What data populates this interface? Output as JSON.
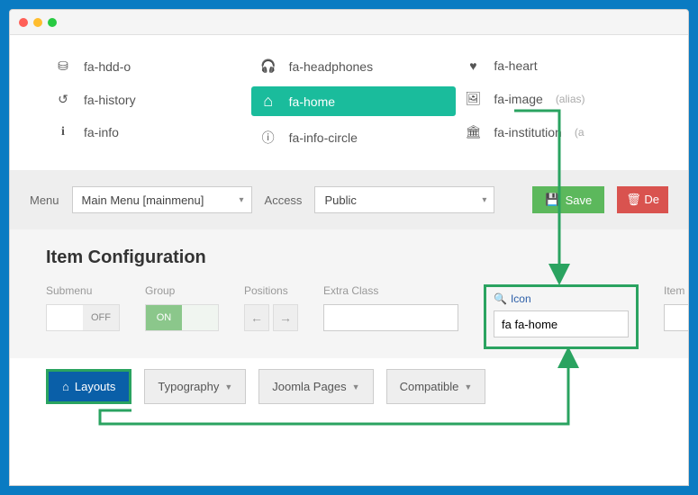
{
  "iconPicker": {
    "col1": [
      {
        "glyph": "⛁",
        "label": "fa-hdd-o"
      },
      {
        "glyph": "↺",
        "label": "fa-history"
      },
      {
        "glyph": "i",
        "label": "fa-info"
      }
    ],
    "col2": [
      {
        "glyph": "🎧",
        "label": "fa-headphones"
      },
      {
        "glyph": "⌂",
        "label": "fa-home",
        "selected": true
      },
      {
        "glyph": "ⓘ",
        "label": "fa-info-circle"
      }
    ],
    "col3": [
      {
        "glyph": "♥",
        "label": "fa-heart"
      },
      {
        "glyph": "🖼",
        "label": "fa-image",
        "alias": "(alias)"
      },
      {
        "glyph": "🏛",
        "label": "fa-institution",
        "alias": "(a"
      }
    ]
  },
  "toolbar": {
    "menuLabel": "Menu",
    "menuValue": "Main Menu [mainmenu]",
    "accessLabel": "Access",
    "accessValue": "Public",
    "saveLabel": "Save",
    "deleteLabel": "De"
  },
  "config": {
    "heading": "Item Configuration",
    "submenuLabel": "Submenu",
    "submenuValue": "OFF",
    "groupLabel": "Group",
    "groupValue": "ON",
    "positionsLabel": "Positions",
    "extraClassLabel": "Extra Class",
    "extraClassValue": "",
    "iconLabel": "Icon",
    "iconValue": "fa fa-home",
    "itemLabel": "Item"
  },
  "navtabs": {
    "layouts": "Layouts",
    "typography": "Typography",
    "joomla": "Joomla Pages",
    "compatible": "Compatible"
  },
  "annotation": {
    "color": "#2aa360"
  }
}
